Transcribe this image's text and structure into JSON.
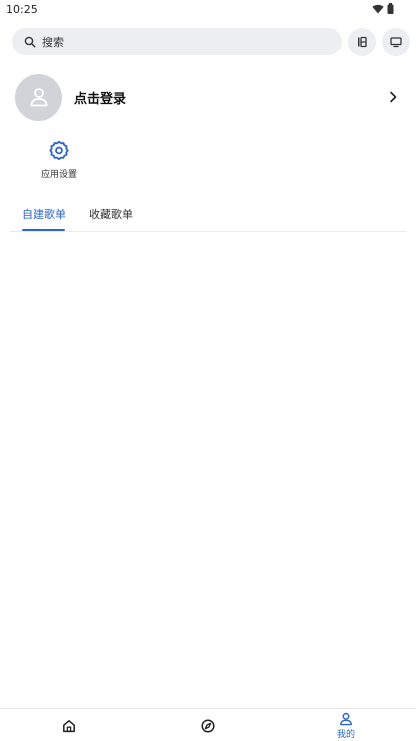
{
  "status_bar": {
    "time": "10:25"
  },
  "header": {
    "search_placeholder": "搜索",
    "icons": [
      "search-icon",
      "history-icon",
      "tv-icon"
    ]
  },
  "profile": {
    "login_label": "点击登录"
  },
  "shortcuts": {
    "settings_label": "应用设置"
  },
  "tabs": [
    {
      "label": "自建歌单",
      "active": true
    },
    {
      "label": "收藏歌单",
      "active": false
    }
  ],
  "bottom_nav": {
    "items": [
      {
        "label": "",
        "icon": "home-icon",
        "active": false
      },
      {
        "label": "",
        "icon": "compass-icon",
        "active": false
      },
      {
        "label": "我的",
        "icon": "user-icon",
        "active": true
      }
    ]
  },
  "colors": {
    "accent": "#2f66c4",
    "surface": "#eceef1",
    "avatar": "#d0d4d9"
  }
}
